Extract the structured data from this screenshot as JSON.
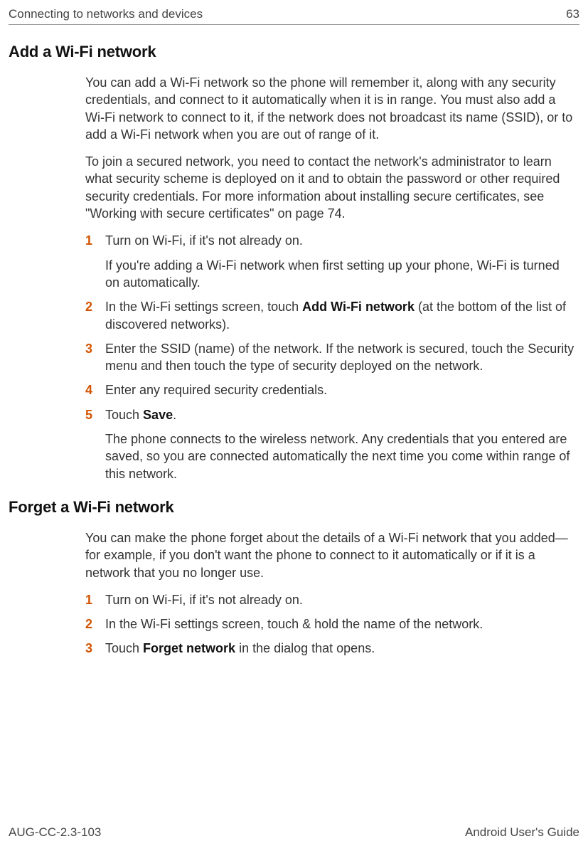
{
  "header": {
    "left": "Connecting to networks and devices",
    "right": "63"
  },
  "sections": [
    {
      "title": "Add a Wi-Fi network",
      "paras": [
        "You can add a Wi-Fi network so the phone will remember it, along with any security credentials, and connect to it automatically when it is in range. You must also add a Wi-Fi network to connect to it, if the network does not broadcast its name (SSID), or to add a Wi-Fi network when you are out of range of it.",
        "To join a secured network, you need to contact the network's administrator to learn what security scheme is deployed on it and to obtain the password or other required security credentials. For more information about installing secure certificates, see \"Working with secure certificates\" on page 74."
      ],
      "steps": [
        {
          "num": "1",
          "lines": [
            [
              {
                "t": "Turn on Wi-Fi, if it's not already on."
              }
            ],
            [
              {
                "t": "If you're adding a Wi-Fi network when first setting up your phone, Wi-Fi is turned on automatically."
              }
            ]
          ]
        },
        {
          "num": "2",
          "lines": [
            [
              {
                "t": "In the Wi-Fi settings screen, touch "
              },
              {
                "t": "Add Wi-Fi network",
                "b": true
              },
              {
                "t": " (at the bottom of the list of discovered networks)."
              }
            ]
          ]
        },
        {
          "num": "3",
          "lines": [
            [
              {
                "t": "Enter the SSID (name) of the network. If the network is secured, touch the Security menu and then touch the type of security deployed on the network."
              }
            ]
          ]
        },
        {
          "num": "4",
          "lines": [
            [
              {
                "t": "Enter any required security credentials."
              }
            ]
          ]
        },
        {
          "num": "5",
          "lines": [
            [
              {
                "t": "Touch "
              },
              {
                "t": "Save",
                "b": true
              },
              {
                "t": "."
              }
            ],
            [
              {
                "t": "The phone connects to the wireless network. Any credentials that you entered are saved, so you are connected automatically the next time you come within range of this network."
              }
            ]
          ]
        }
      ]
    },
    {
      "title": "Forget a Wi-Fi network",
      "paras": [
        "You can make the phone forget about the details of a Wi-Fi network that you added—for example, if you don't want the phone to connect to it automatically or if it is a network that you no longer use."
      ],
      "steps": [
        {
          "num": "1",
          "lines": [
            [
              {
                "t": "Turn on Wi-Fi, if it's not already on."
              }
            ]
          ]
        },
        {
          "num": "2",
          "lines": [
            [
              {
                "t": "In the Wi-Fi settings screen, touch & hold the name of the network."
              }
            ]
          ]
        },
        {
          "num": "3",
          "lines": [
            [
              {
                "t": "Touch "
              },
              {
                "t": "Forget network",
                "b": true
              },
              {
                "t": " in the dialog that opens."
              }
            ]
          ]
        }
      ]
    }
  ],
  "footer": {
    "left": "AUG-CC-2.3-103",
    "right": "Android User's Guide"
  }
}
